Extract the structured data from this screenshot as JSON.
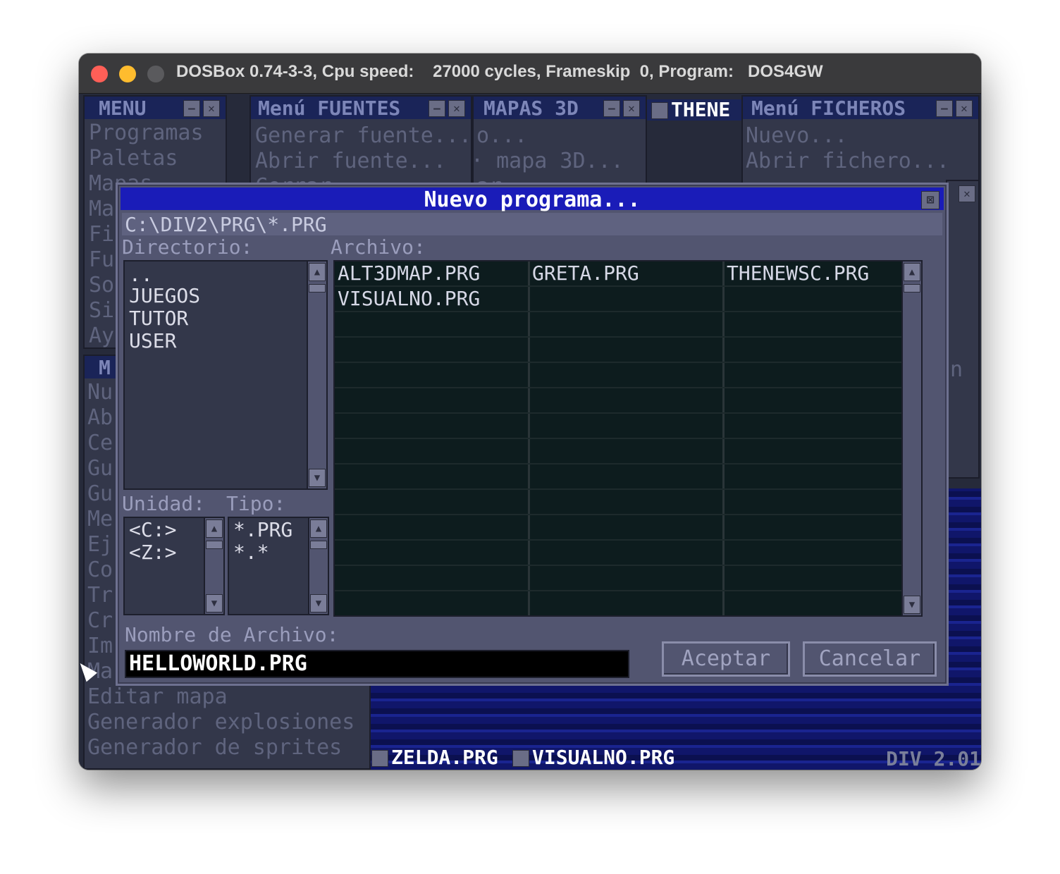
{
  "window": {
    "title": "DOSBox 0.74-3-3, Cpu speed:    27000 cycles, Frameskip  0, Program:   DOS4GW"
  },
  "bg_windows": {
    "menu": {
      "title": "MENU",
      "items": [
        "Programas",
        "Paletas",
        "Mapas",
        "Ma",
        "Fi",
        "Fu",
        "So",
        "Si",
        "Ay"
      ]
    },
    "fuentes": {
      "title": "Menú FUENTES",
      "items": [
        "Generar fuente...",
        "Abrir fuente...",
        "Cerrar"
      ]
    },
    "mapas3d": {
      "title": "MAPAS 3D",
      "items": [
        "o...",
        "· mapa 3D...",
        "ar"
      ]
    },
    "thene": {
      "title": "THENE"
    },
    "ficheros": {
      "title": "Menú FICHEROS",
      "items": [
        "Nuevo...",
        "Abrir fichero...",
        "-"
      ]
    },
    "mapas_menu": {
      "title": "M",
      "items": [
        "Nu",
        "Ab",
        "Ce",
        "Gu",
        "Gu",
        "Me",
        "Ej",
        "Co",
        "Tr",
        "Cr",
        "Im",
        "Ma",
        "Editar mapa",
        "Generador explosiones",
        "Generador de sprites"
      ]
    },
    "partial_right": {
      "items": [
        "n"
      ]
    }
  },
  "dialog": {
    "title": "Nuevo programa...",
    "close_glyph": "⊠",
    "path": "C:\\DIV2\\PRG\\*.PRG",
    "directorio_label": "Directorio:",
    "archivo_label": "Archivo:",
    "directories": [
      "..",
      "JUEGOS",
      "TUTOR",
      "USER"
    ],
    "files": [
      "ALT3DMAP.PRG",
      "GRETA.PRG",
      "THENEWSC.PRG",
      "VISUALNO.PRG"
    ],
    "unidad_label": "Unidad:",
    "tipo_label": "Tipo:",
    "drives": [
      "<C:>",
      "<Z:>"
    ],
    "types": [
      "*.PRG",
      "*.*"
    ],
    "filename_label": "Nombre de Archivo:",
    "filename_value": "HELLOWORLD.PRG",
    "accept_label": "Aceptar",
    "cancel_label": "Cancelar"
  },
  "taskbar": {
    "items": [
      "ZELDA.PRG",
      "VISUALNO.PRG"
    ],
    "version": "DIV 2.01"
  },
  "colors": {
    "dialog_title_bg": "#1a1cb8",
    "dialog_bg": "#525570",
    "file_list_bg": "#0d1c1e"
  },
  "icons": {
    "scroll_up": "▲",
    "scroll_down": "▼",
    "minimize": "—",
    "close": "✕"
  }
}
